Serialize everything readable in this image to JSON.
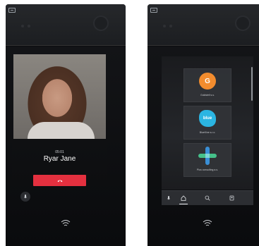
{
  "call": {
    "timer": "05:01",
    "caller_name": "Ryar Jane"
  },
  "directory": {
    "companies": [
      {
        "name": "Goldstell s.s.",
        "logo_text": "G",
        "color": "#f28c2e"
      },
      {
        "name": "BlueKine s.r.o.",
        "logo_text": "blue",
        "color": "#2bb5e2"
      },
      {
        "name": "Plus consulting a.s.",
        "logo_text": "",
        "color": "#3a8fd6"
      }
    ]
  },
  "icons": {
    "logo": "intercom-logo-icon",
    "mic": "microphone-icon",
    "hangup": "phone-hangup-icon",
    "nfc": "nfc-wave-icon",
    "home": "home-icon",
    "search": "search-icon",
    "contacts": "contacts-icon"
  },
  "colors": {
    "hangup": "#e4303f",
    "background": "#0b0c0e"
  }
}
